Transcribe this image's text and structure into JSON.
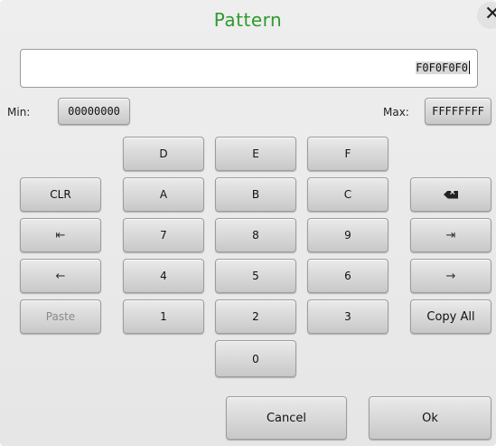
{
  "dialog": {
    "title": "Pattern",
    "title_color": "#2f9a2f",
    "close_icon": "close-icon"
  },
  "field": {
    "value": "F0F0F0F0"
  },
  "limits": {
    "min_label": "Min:",
    "min_value": "00000000",
    "max_label": "Max:",
    "max_value": "FFFFFFFF"
  },
  "keys": {
    "d": "D",
    "e": "E",
    "f": "F",
    "a": "A",
    "b": "B",
    "c": "C",
    "n7": "7",
    "n8": "8",
    "n9": "9",
    "n4": "4",
    "n5": "5",
    "n6": "6",
    "n1": "1",
    "n2": "2",
    "n3": "3",
    "n0": "0"
  },
  "side": {
    "clr": "CLR",
    "paste": "Paste",
    "copy_all": "Copy All",
    "backspace_icon": "backspace-icon",
    "home_icon": "move-to-start-icon",
    "end_icon": "move-to-end-icon",
    "left_icon": "arrow-left-icon",
    "right_icon": "arrow-right-icon"
  },
  "footer": {
    "cancel": "Cancel",
    "ok": "Ok"
  }
}
